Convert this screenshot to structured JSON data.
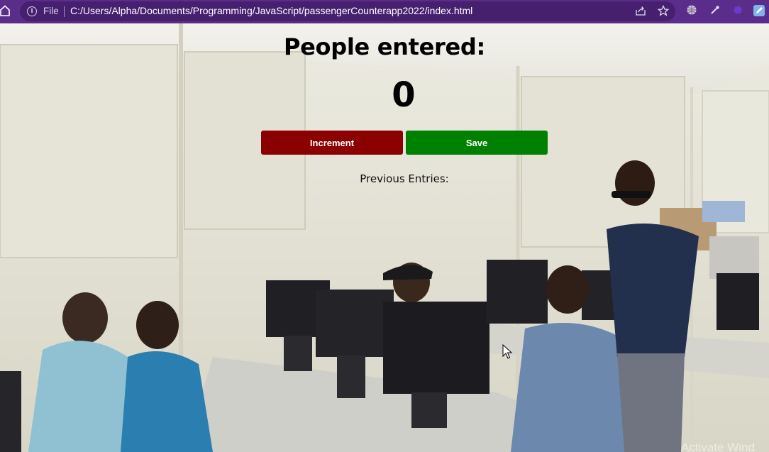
{
  "browser": {
    "file_label": "File",
    "url": "C:/Users/Alpha/Documents/Programming/JavaScript/passengerCounterapp2022/index.html",
    "icons": [
      "home-icon",
      "info-icon",
      "share-icon",
      "star-icon",
      "globe-icon",
      "eyedropper-icon",
      "extension-icon",
      "edit-icon"
    ]
  },
  "page": {
    "title": "People entered:",
    "count": "0",
    "increment_label": "Increment",
    "save_label": "Save",
    "previous_entries_label": "Previous Entries:",
    "watermark": "Activate Wind"
  },
  "colors": {
    "increment_button": "#8b0000",
    "save_button": "#008000",
    "browser_frame": "#5a2d8a"
  }
}
